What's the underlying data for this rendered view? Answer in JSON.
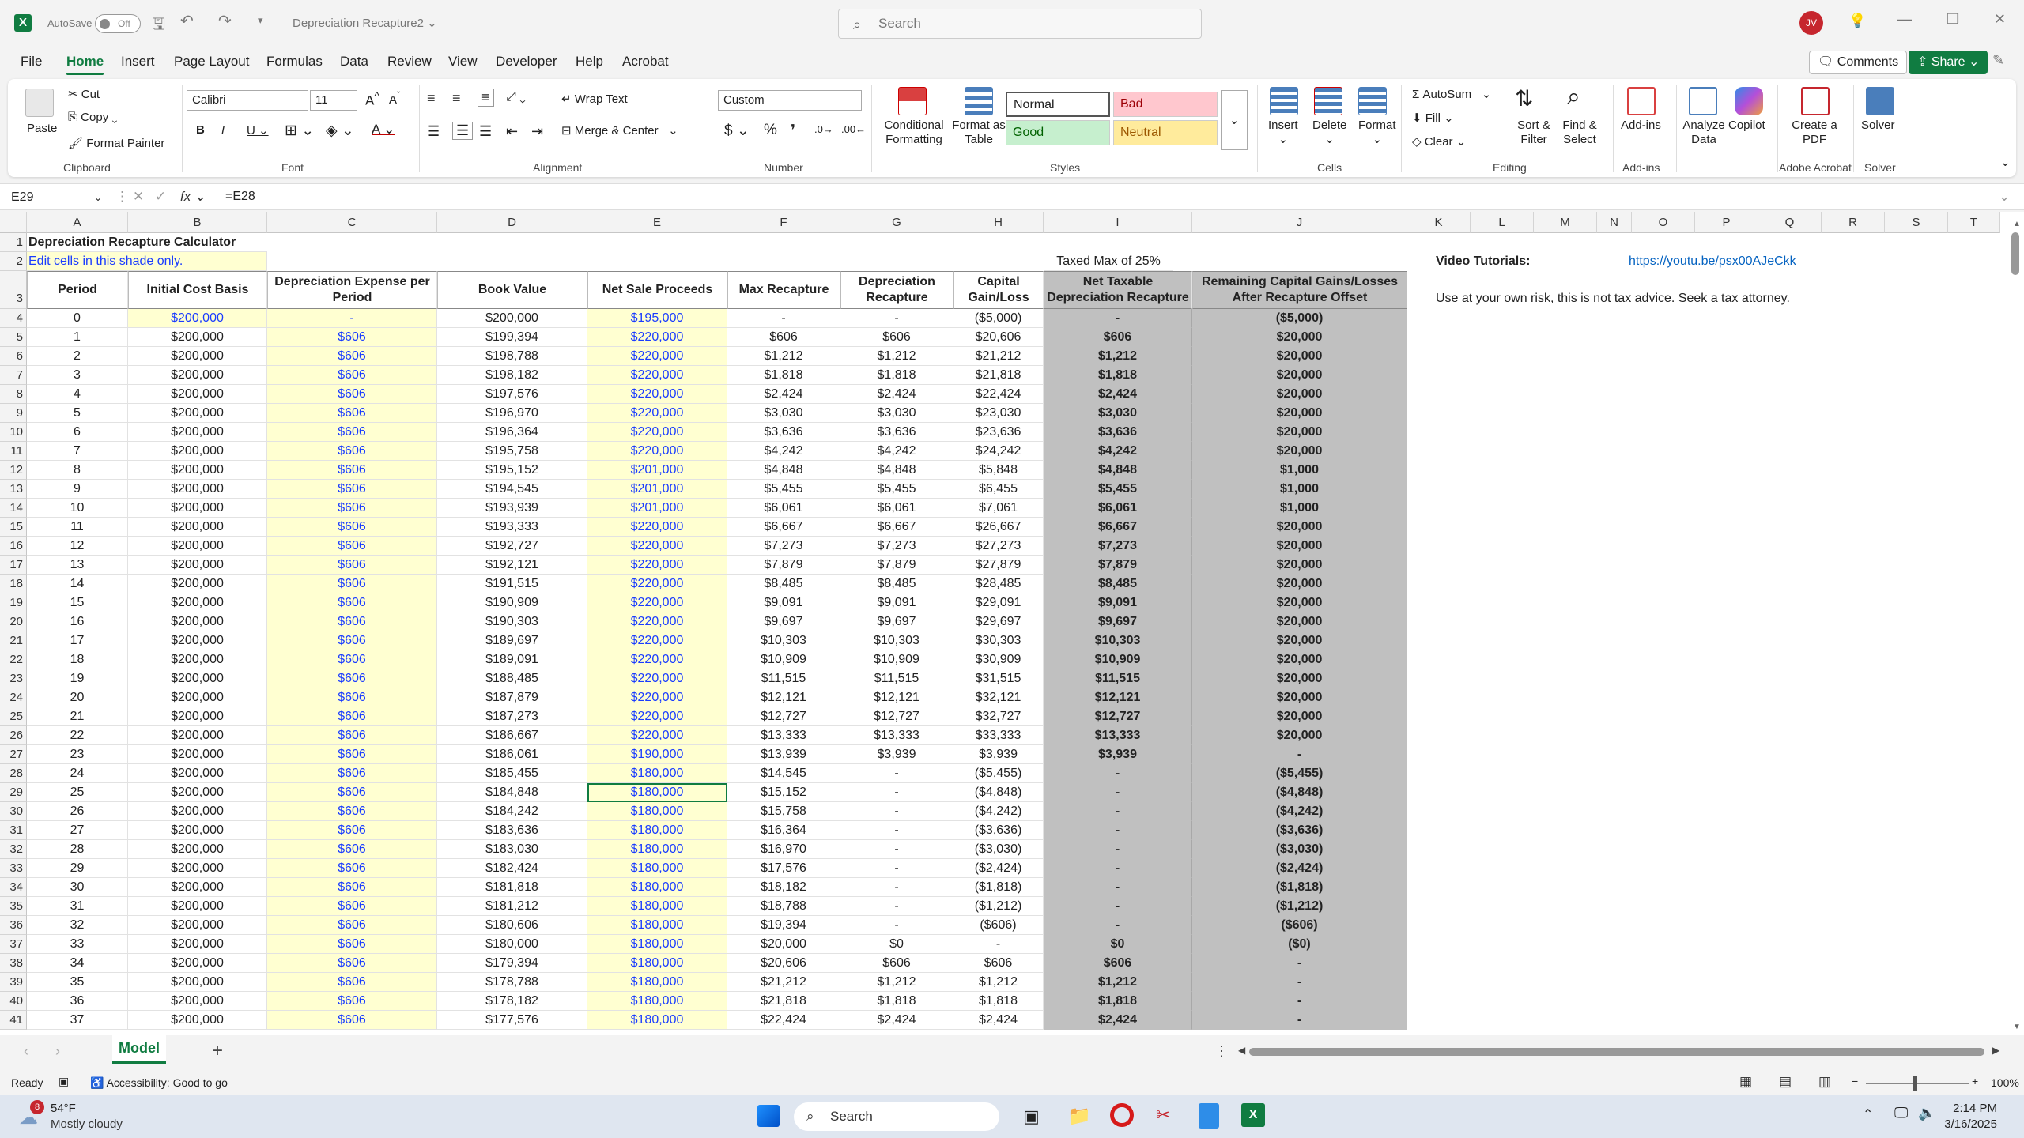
{
  "app": {
    "autosave": "AutoSave",
    "autosave_state": "Off",
    "doc_title": "Depreciation Recapture2",
    "search_placeholder": "Search",
    "user_initials": "JV"
  },
  "menu": [
    "File",
    "Home",
    "Insert",
    "Page Layout",
    "Formulas",
    "Data",
    "Review",
    "View",
    "Developer",
    "Help",
    "Acrobat"
  ],
  "ribbon_right": {
    "comments": "Comments",
    "share": "Share"
  },
  "ribbon": {
    "clipboard": {
      "paste": "Paste",
      "cut": "Cut",
      "copy": "Copy",
      "format_painter": "Format Painter",
      "label": "Clipboard"
    },
    "font": {
      "name": "Calibri",
      "size": "11",
      "label": "Font"
    },
    "alignment": {
      "wrap": "Wrap Text",
      "merge": "Merge & Center",
      "label": "Alignment"
    },
    "number": {
      "format": "Custom",
      "label": "Number"
    },
    "styles": {
      "cond": "Conditional Formatting",
      "table": "Format as Table",
      "normal": "Normal",
      "bad": "Bad",
      "good": "Good",
      "neutral": "Neutral",
      "label": "Styles"
    },
    "cells": {
      "insert": "Insert",
      "delete": "Delete",
      "format": "Format",
      "label": "Cells"
    },
    "editing": {
      "autosum": "AutoSum",
      "fill": "Fill",
      "clear": "Clear",
      "sort": "Sort & Filter",
      "find": "Find & Select",
      "label": "Editing"
    },
    "addins": {
      "addins": "Add-ins",
      "label": "Add-ins"
    },
    "analyze": "Analyze Data",
    "copilot": "Copilot",
    "acrobat": {
      "create": "Create a PDF",
      "label": "Adobe Acrobat"
    },
    "solver": {
      "solver": "Solver",
      "label": "Solver"
    }
  },
  "formula": {
    "cell_ref": "E29",
    "formula": "=E28"
  },
  "columns": [
    "A",
    "B",
    "C",
    "D",
    "E",
    "F",
    "G",
    "H",
    "I",
    "J",
    "K",
    "L",
    "M",
    "N",
    "O",
    "P",
    "Q",
    "R",
    "S",
    "T"
  ],
  "sheet": {
    "title": "Depreciation Recapture Calculator",
    "edit_note": "Edit cells in this shade only.",
    "taxed_max": "Taxed Max of 25%",
    "video_label": "Video Tutorials:",
    "video_link": "https://youtu.be/psx00AJeCkk",
    "disclaimer": "Use at your own risk, this is not tax advice. Seek a tax attorney.",
    "headers": [
      "Period",
      "Initial Cost Basis",
      "Depreciation Expense per Period",
      "Book Value",
      "Net Sale Proceeds",
      "Max Recapture",
      "Depreciation Recapture",
      "Capital Gain/Loss",
      "Net Taxable Depreciation Recapture",
      "Remaining Capital Gains/Losses After Recapture Offset"
    ],
    "rows": [
      [
        "0",
        "$200,000",
        "-",
        "$200,000",
        "$195,000",
        "-",
        "-",
        "($5,000)",
        "-",
        "($5,000)"
      ],
      [
        "1",
        "$200,000",
        "$606",
        "$199,394",
        "$220,000",
        "$606",
        "$606",
        "$20,606",
        "$606",
        "$20,000"
      ],
      [
        "2",
        "$200,000",
        "$606",
        "$198,788",
        "$220,000",
        "$1,212",
        "$1,212",
        "$21,212",
        "$1,212",
        "$20,000"
      ],
      [
        "3",
        "$200,000",
        "$606",
        "$198,182",
        "$220,000",
        "$1,818",
        "$1,818",
        "$21,818",
        "$1,818",
        "$20,000"
      ],
      [
        "4",
        "$200,000",
        "$606",
        "$197,576",
        "$220,000",
        "$2,424",
        "$2,424",
        "$22,424",
        "$2,424",
        "$20,000"
      ],
      [
        "5",
        "$200,000",
        "$606",
        "$196,970",
        "$220,000",
        "$3,030",
        "$3,030",
        "$23,030",
        "$3,030",
        "$20,000"
      ],
      [
        "6",
        "$200,000",
        "$606",
        "$196,364",
        "$220,000",
        "$3,636",
        "$3,636",
        "$23,636",
        "$3,636",
        "$20,000"
      ],
      [
        "7",
        "$200,000",
        "$606",
        "$195,758",
        "$220,000",
        "$4,242",
        "$4,242",
        "$24,242",
        "$4,242",
        "$20,000"
      ],
      [
        "8",
        "$200,000",
        "$606",
        "$195,152",
        "$201,000",
        "$4,848",
        "$4,848",
        "$5,848",
        "$4,848",
        "$1,000"
      ],
      [
        "9",
        "$200,000",
        "$606",
        "$194,545",
        "$201,000",
        "$5,455",
        "$5,455",
        "$6,455",
        "$5,455",
        "$1,000"
      ],
      [
        "10",
        "$200,000",
        "$606",
        "$193,939",
        "$201,000",
        "$6,061",
        "$6,061",
        "$7,061",
        "$6,061",
        "$1,000"
      ],
      [
        "11",
        "$200,000",
        "$606",
        "$193,333",
        "$220,000",
        "$6,667",
        "$6,667",
        "$26,667",
        "$6,667",
        "$20,000"
      ],
      [
        "12",
        "$200,000",
        "$606",
        "$192,727",
        "$220,000",
        "$7,273",
        "$7,273",
        "$27,273",
        "$7,273",
        "$20,000"
      ],
      [
        "13",
        "$200,000",
        "$606",
        "$192,121",
        "$220,000",
        "$7,879",
        "$7,879",
        "$27,879",
        "$7,879",
        "$20,000"
      ],
      [
        "14",
        "$200,000",
        "$606",
        "$191,515",
        "$220,000",
        "$8,485",
        "$8,485",
        "$28,485",
        "$8,485",
        "$20,000"
      ],
      [
        "15",
        "$200,000",
        "$606",
        "$190,909",
        "$220,000",
        "$9,091",
        "$9,091",
        "$29,091",
        "$9,091",
        "$20,000"
      ],
      [
        "16",
        "$200,000",
        "$606",
        "$190,303",
        "$220,000",
        "$9,697",
        "$9,697",
        "$29,697",
        "$9,697",
        "$20,000"
      ],
      [
        "17",
        "$200,000",
        "$606",
        "$189,697",
        "$220,000",
        "$10,303",
        "$10,303",
        "$30,303",
        "$10,303",
        "$20,000"
      ],
      [
        "18",
        "$200,000",
        "$606",
        "$189,091",
        "$220,000",
        "$10,909",
        "$10,909",
        "$30,909",
        "$10,909",
        "$20,000"
      ],
      [
        "19",
        "$200,000",
        "$606",
        "$188,485",
        "$220,000",
        "$11,515",
        "$11,515",
        "$31,515",
        "$11,515",
        "$20,000"
      ],
      [
        "20",
        "$200,000",
        "$606",
        "$187,879",
        "$220,000",
        "$12,121",
        "$12,121",
        "$32,121",
        "$12,121",
        "$20,000"
      ],
      [
        "21",
        "$200,000",
        "$606",
        "$187,273",
        "$220,000",
        "$12,727",
        "$12,727",
        "$32,727",
        "$12,727",
        "$20,000"
      ],
      [
        "22",
        "$200,000",
        "$606",
        "$186,667",
        "$220,000",
        "$13,333",
        "$13,333",
        "$33,333",
        "$13,333",
        "$20,000"
      ],
      [
        "23",
        "$200,000",
        "$606",
        "$186,061",
        "$190,000",
        "$13,939",
        "$3,939",
        "$3,939",
        "$3,939",
        "-"
      ],
      [
        "24",
        "$200,000",
        "$606",
        "$185,455",
        "$180,000",
        "$14,545",
        "-",
        "($5,455)",
        "-",
        "($5,455)"
      ],
      [
        "25",
        "$200,000",
        "$606",
        "$184,848",
        "$180,000",
        "$15,152",
        "-",
        "($4,848)",
        "-",
        "($4,848)"
      ],
      [
        "26",
        "$200,000",
        "$606",
        "$184,242",
        "$180,000",
        "$15,758",
        "-",
        "($4,242)",
        "-",
        "($4,242)"
      ],
      [
        "27",
        "$200,000",
        "$606",
        "$183,636",
        "$180,000",
        "$16,364",
        "-",
        "($3,636)",
        "-",
        "($3,636)"
      ],
      [
        "28",
        "$200,000",
        "$606",
        "$183,030",
        "$180,000",
        "$16,970",
        "-",
        "($3,030)",
        "-",
        "($3,030)"
      ],
      [
        "29",
        "$200,000",
        "$606",
        "$182,424",
        "$180,000",
        "$17,576",
        "-",
        "($2,424)",
        "-",
        "($2,424)"
      ],
      [
        "30",
        "$200,000",
        "$606",
        "$181,818",
        "$180,000",
        "$18,182",
        "-",
        "($1,818)",
        "-",
        "($1,818)"
      ],
      [
        "31",
        "$200,000",
        "$606",
        "$181,212",
        "$180,000",
        "$18,788",
        "-",
        "($1,212)",
        "-",
        "($1,212)"
      ],
      [
        "32",
        "$200,000",
        "$606",
        "$180,606",
        "$180,000",
        "$19,394",
        "-",
        "($606)",
        "-",
        "($606)"
      ],
      [
        "33",
        "$200,000",
        "$606",
        "$180,000",
        "$180,000",
        "$20,000",
        "$0",
        "-",
        "$0",
        "($0)"
      ],
      [
        "34",
        "$200,000",
        "$606",
        "$179,394",
        "$180,000",
        "$20,606",
        "$606",
        "$606",
        "$606",
        "-"
      ],
      [
        "35",
        "$200,000",
        "$606",
        "$178,788",
        "$180,000",
        "$21,212",
        "$1,212",
        "$1,212",
        "$1,212",
        "-"
      ],
      [
        "36",
        "$200,000",
        "$606",
        "$178,182",
        "$180,000",
        "$21,818",
        "$1,818",
        "$1,818",
        "$1,818",
        "-"
      ],
      [
        "37",
        "$200,000",
        "$606",
        "$177,576",
        "$180,000",
        "$22,424",
        "$2,424",
        "$2,424",
        "$2,424",
        "-"
      ]
    ]
  },
  "tabs": {
    "active": "Model"
  },
  "status": {
    "ready": "Ready",
    "accessibility": "Accessibility: Good to go",
    "zoom": "100%"
  },
  "taskbar": {
    "temp": "54°F",
    "weather": "Mostly cloudy",
    "badge": "8",
    "search": "Search",
    "time": "2:14 PM",
    "date": "3/16/2025"
  }
}
